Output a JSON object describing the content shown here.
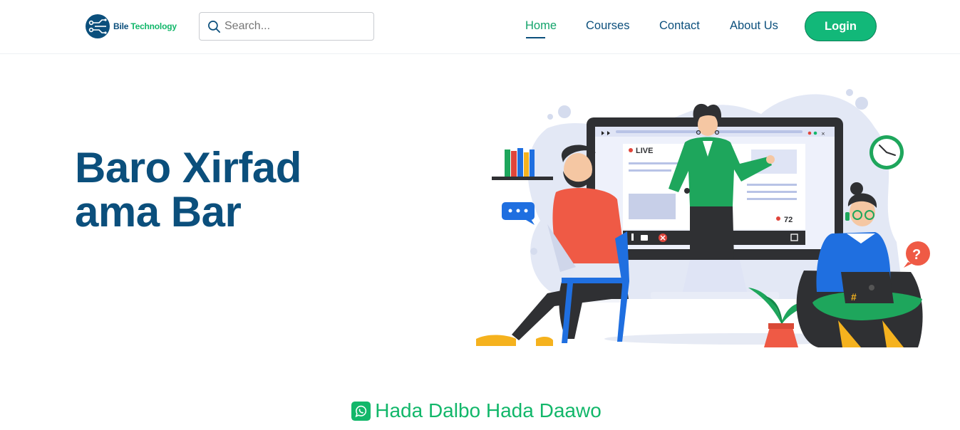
{
  "header": {
    "logo": {
      "word1": "Bile",
      "word2": "Technology"
    },
    "search": {
      "placeholder": "Search..."
    },
    "nav": [
      {
        "label": "Home",
        "active": true
      },
      {
        "label": "Courses",
        "active": false
      },
      {
        "label": "Contact",
        "active": false
      },
      {
        "label": "About Us",
        "active": false
      }
    ],
    "login_label": "Login"
  },
  "hero": {
    "title_line1": "Baro Xirfad",
    "title_line2": "ama Bar",
    "illustration": {
      "live_label": "LIVE",
      "viewer_count": "72"
    }
  },
  "cta": {
    "icon": "whatsapp-icon",
    "text": "Hada Dalbo Hada Daawo"
  },
  "colors": {
    "primary": "#0b4f7c",
    "accent": "#12b76a",
    "login_bg": "#12b879"
  }
}
